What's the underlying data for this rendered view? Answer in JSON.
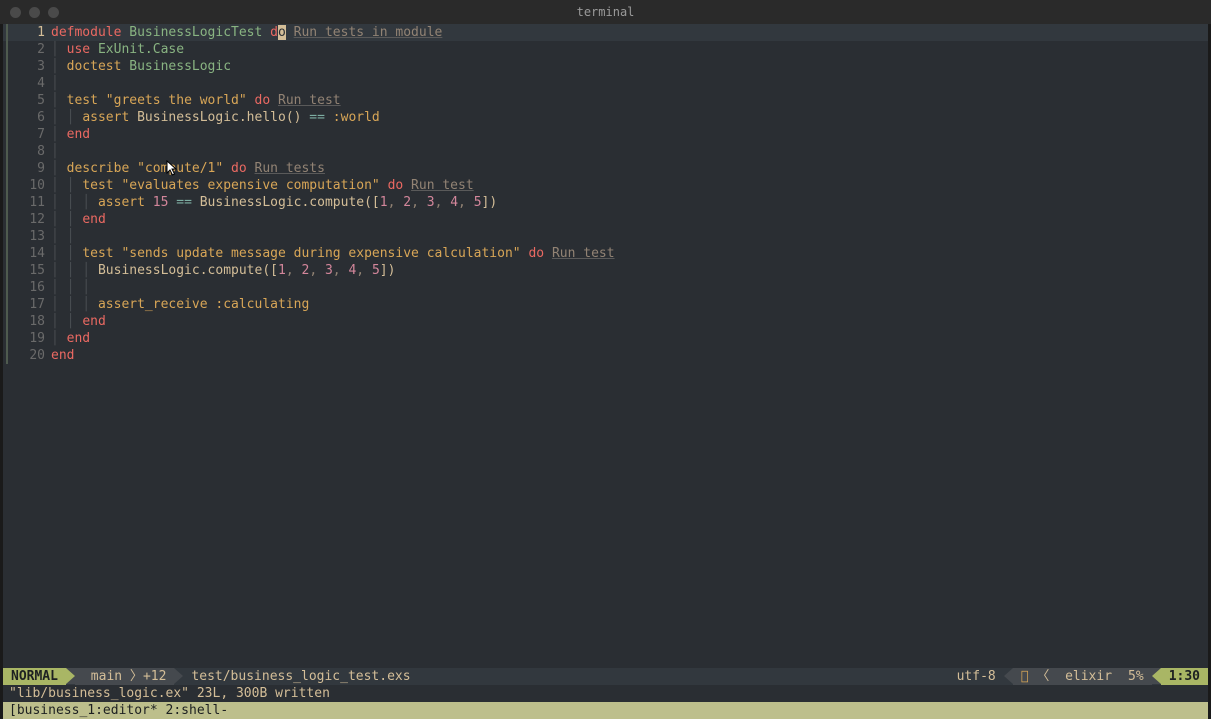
{
  "window": {
    "title": "terminal"
  },
  "statusline": {
    "mode": "NORMAL",
    "branch_icon": "",
    "branch": "main",
    "vcs_changes": "+12",
    "file": "test/business_logic_test.exs",
    "encoding": "utf-8",
    "diag_hint_icon": "󰛩",
    "diag_hint_count": "",
    "filetype_icon": "",
    "filetype": "elixir",
    "percent": "5%",
    "linecol": "1:30"
  },
  "message": "\"lib/business_logic.ex\" 23L, 300B written",
  "tmux": "[business_1:editor* 2:shell-",
  "lenses": {
    "module": "Run tests in module",
    "test": "Run test",
    "describe": "Run tests"
  },
  "code": {
    "l1": {
      "n": "1",
      "kw": "defmodule",
      "mod": "BusinessLogicTest",
      "do_pre": "d",
      "do_cur": "o"
    },
    "l2": {
      "n": "2",
      "use": "use",
      "mod": "ExUnit.Case"
    },
    "l3": {
      "n": "3",
      "doctest": "doctest",
      "mod": "BusinessLogic"
    },
    "l4": {
      "n": "4"
    },
    "l5": {
      "n": "5",
      "test": "test",
      "str": "\"greets the world\"",
      "do": "do"
    },
    "l6": {
      "n": "6",
      "assert": "assert",
      "call": "BusinessLogic.hello",
      "parens": "()",
      "op": " == ",
      "atom": ":world"
    },
    "l7": {
      "n": "7",
      "end": "end"
    },
    "l8": {
      "n": "8"
    },
    "l9": {
      "n": "9",
      "desc": "describe",
      "str": "\"compute/1\"",
      "do": "do"
    },
    "l10": {
      "n": "10",
      "test": "test",
      "str": "\"evaluates expensive computation\"",
      "do": "do"
    },
    "l11": {
      "n": "11",
      "assert": "assert",
      "num": "15",
      "op": " == ",
      "call": "BusinessLogic.compute",
      "lb": "([",
      "a1": "1",
      "c": ", ",
      "a2": "2",
      "a3": "3",
      "a4": "4",
      "a5": "5",
      "rb": "])"
    },
    "l12": {
      "n": "12",
      "end": "end"
    },
    "l13": {
      "n": "13"
    },
    "l14": {
      "n": "14",
      "test": "test",
      "str": "\"sends update message during expensive calculation\"",
      "do": "do"
    },
    "l15": {
      "n": "15",
      "call": "BusinessLogic.compute",
      "lb": "([",
      "a1": "1",
      "c": ", ",
      "a2": "2",
      "a3": "3",
      "a4": "4",
      "a5": "5",
      "rb": "])"
    },
    "l16": {
      "n": "16"
    },
    "l17": {
      "n": "17",
      "ar": "assert_receive",
      "atom": ":calculating"
    },
    "l18": {
      "n": "18",
      "end": "end"
    },
    "l19": {
      "n": "19",
      "end": "end"
    },
    "l20": {
      "n": "20",
      "end": "end"
    }
  }
}
